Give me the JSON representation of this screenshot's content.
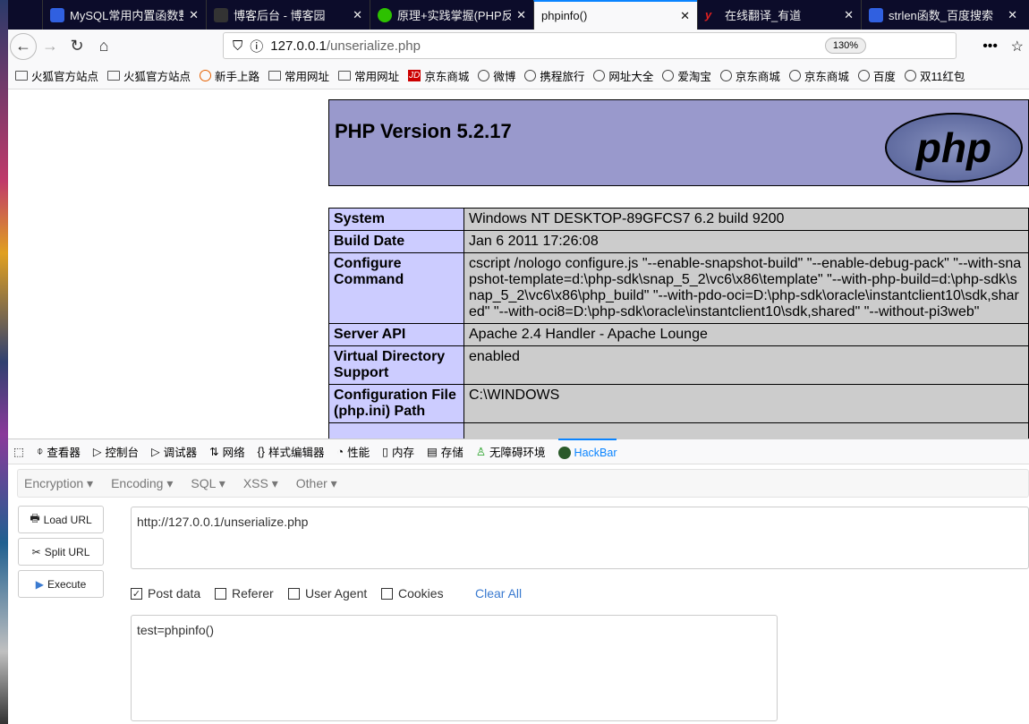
{
  "tabs": [
    {
      "title": "MySQL常用内置函数整"
    },
    {
      "title": "博客后台 - 博客园"
    },
    {
      "title": "原理+实践掌握(PHP反"
    },
    {
      "title": "phpinfo()"
    },
    {
      "title": "在线翻译_有道"
    },
    {
      "title": "strlen函数_百度搜索"
    }
  ],
  "nav": {
    "url_host": "127.0.0.1",
    "url_path": "/unserialize.php",
    "zoom": "130%"
  },
  "bookmarks": [
    "火狐官方站点",
    "火狐官方站点",
    "新手上路",
    "常用网址",
    "常用网址",
    "京东商城",
    "微博",
    "携程旅行",
    "网址大全",
    "爱淘宝",
    "京东商城",
    "京东商城",
    "百度",
    "双11红包"
  ],
  "php": {
    "title": "PHP Version 5.2.17",
    "logo": "php",
    "rows": [
      {
        "k": "System",
        "v": "Windows NT DESKTOP-89GFCS7 6.2 build 9200"
      },
      {
        "k": "Build Date",
        "v": "Jan 6 2011 17:26:08"
      },
      {
        "k": "Configure Command",
        "v": "cscript /nologo configure.js \"--enable-snapshot-build\" \"--enable-debug-pack\" \"--with-snapshot-template=d:\\php-sdk\\snap_5_2\\vc6\\x86\\template\" \"--with-php-build=d:\\php-sdk\\snap_5_2\\vc6\\x86\\php_build\" \"--with-pdo-oci=D:\\php-sdk\\oracle\\instantclient10\\sdk,shared\" \"--with-oci8=D:\\php-sdk\\oracle\\instantclient10\\sdk,shared\" \"--without-pi3web\""
      },
      {
        "k": "Server API",
        "v": "Apache 2.4 Handler - Apache Lounge"
      },
      {
        "k": "Virtual Directory Support",
        "v": "enabled"
      },
      {
        "k": "Configuration File (php.ini) Path",
        "v": "C:\\WINDOWS"
      }
    ]
  },
  "devtools": [
    "查看器",
    "控制台",
    "调试器",
    "网络",
    "样式编辑器",
    "性能",
    "内存",
    "存储",
    "无障碍环境",
    "HackBar"
  ],
  "hackbar": {
    "menu": [
      "Encryption",
      "Encoding",
      "SQL",
      "XSS",
      "Other"
    ],
    "load": "Load URL",
    "split": "Split URL",
    "execute": "Execute",
    "url": "http://127.0.0.1/unserialize.php",
    "post": "Post data",
    "referer": "Referer",
    "ua": "User Agent",
    "cookies": "Cookies",
    "clear": "Clear All",
    "postdata": "test=phpinfo()"
  }
}
